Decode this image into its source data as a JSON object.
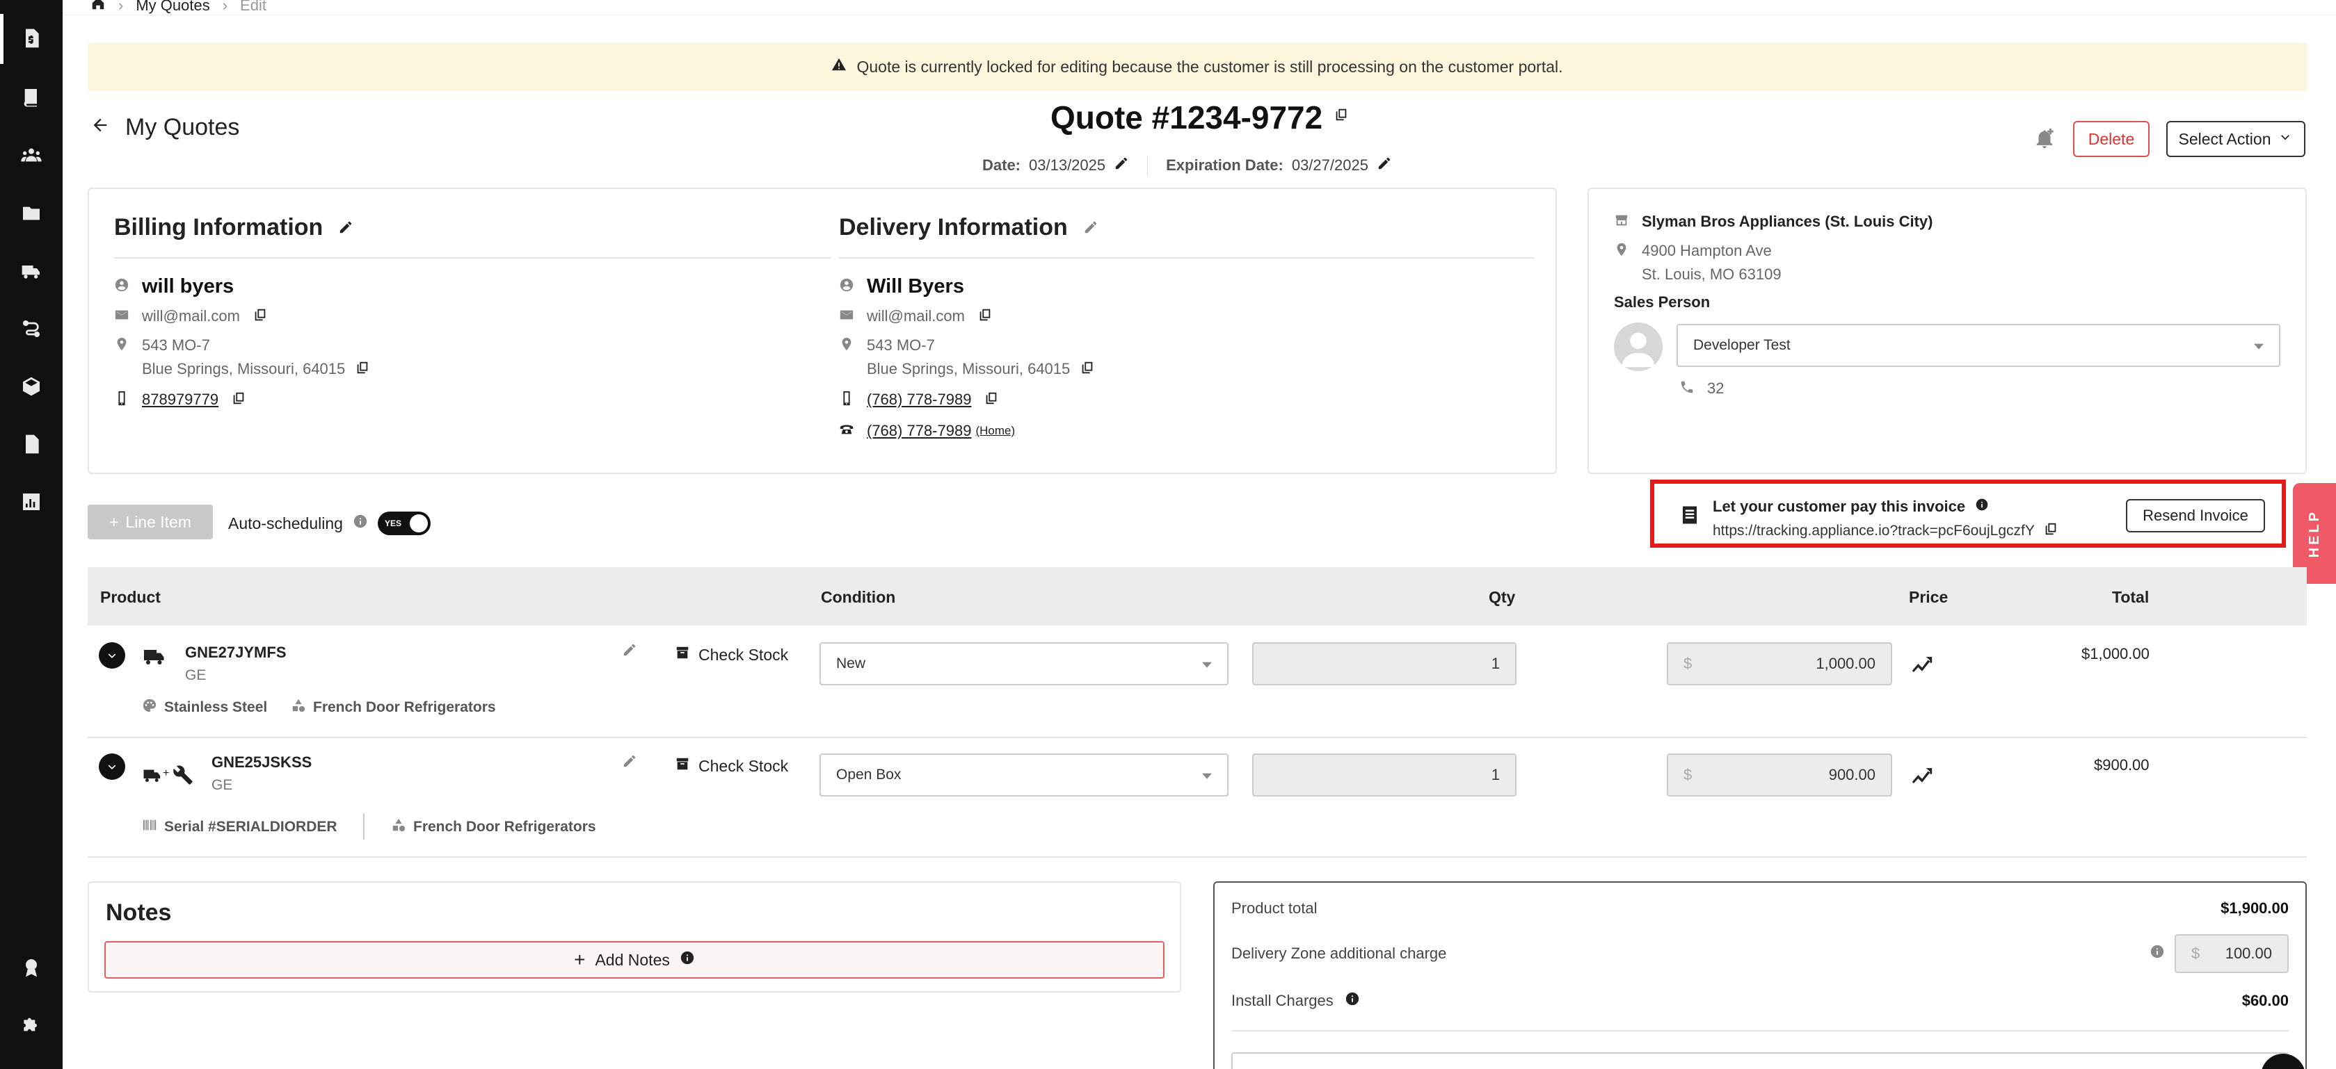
{
  "breadcrumb": {
    "level1": "My Quotes",
    "level2": "Edit"
  },
  "banner": {
    "text": "Quote is currently locked for editing because the customer is still processing on the customer portal."
  },
  "header": {
    "back_label": "My Quotes",
    "quote_title": "Quote #1234-9772",
    "date_label": "Date:",
    "date_value": "03/13/2025",
    "expiration_label": "Expiration Date:",
    "expiration_value": "03/27/2025",
    "delete_label": "Delete",
    "select_action_label": "Select Action"
  },
  "billing": {
    "title": "Billing Information",
    "name": "will byers",
    "email": "will@mail.com",
    "address_line1": "543 MO-7",
    "address_line2": "Blue Springs, Missouri, 64015",
    "phone": "878979779"
  },
  "delivery": {
    "title": "Delivery Information",
    "name": "Will Byers",
    "email": "will@mail.com",
    "address_line1": "543 MO-7",
    "address_line2": "Blue Springs, Missouri, 64015",
    "mobile": "(768) 778-7989",
    "home_phone": "(768) 778-7989",
    "home_tag": "(Home)"
  },
  "store": {
    "name": "Slyman Bros Appliances (St. Louis City)",
    "address_line1": "4900 Hampton Ave",
    "address_line2": "St. Louis, MO 63109",
    "sales_person_label": "Sales Person",
    "sales_person_value": "Developer Test",
    "ext": "32"
  },
  "toolbar": {
    "line_item_label": "Line Item",
    "auto_scheduling_label": "Auto-scheduling",
    "toggle_label": "YES"
  },
  "pay": {
    "title": "Let your customer pay this invoice",
    "url": "https://tracking.appliance.io?track=pcF6oujLgczfY",
    "resend_label": "Resend Invoice"
  },
  "help_label": "HELP",
  "table": {
    "headers": {
      "product": "Product",
      "condition": "Condition",
      "qty": "Qty",
      "price": "Price",
      "total": "Total"
    },
    "rows": [
      {
        "sku": "GNE27JYMFS",
        "brand": "GE",
        "tag1": "Stainless Steel",
        "tag2": "French Door Refrigerators",
        "check_stock": "Check Stock",
        "condition": "New",
        "qty": "1",
        "currency": "$",
        "price": "1,000.00",
        "total": "$1,000.00"
      },
      {
        "sku": "GNE25JSKSS",
        "brand": "GE",
        "tag1": "Serial #SERIALDIORDER",
        "tag2": "French Door Refrigerators",
        "check_stock": "Check Stock",
        "condition": "Open Box",
        "qty": "1",
        "currency": "$",
        "price": "900.00",
        "total": "$900.00"
      }
    ]
  },
  "notes": {
    "title": "Notes",
    "add_label": "Add Notes"
  },
  "summary": {
    "product_total_label": "Product total",
    "product_total_value": "$1,900.00",
    "delivery_zone_label": "Delivery Zone additional charge",
    "delivery_zone_currency": "$",
    "delivery_zone_value": "100.00",
    "install_label": "Install Charges",
    "install_value": "$60.00"
  },
  "colors": {
    "banner_bg": "#fdf6dc",
    "delete": "#e03030",
    "highlight": "#e21b1b",
    "help": "#f05a66"
  }
}
